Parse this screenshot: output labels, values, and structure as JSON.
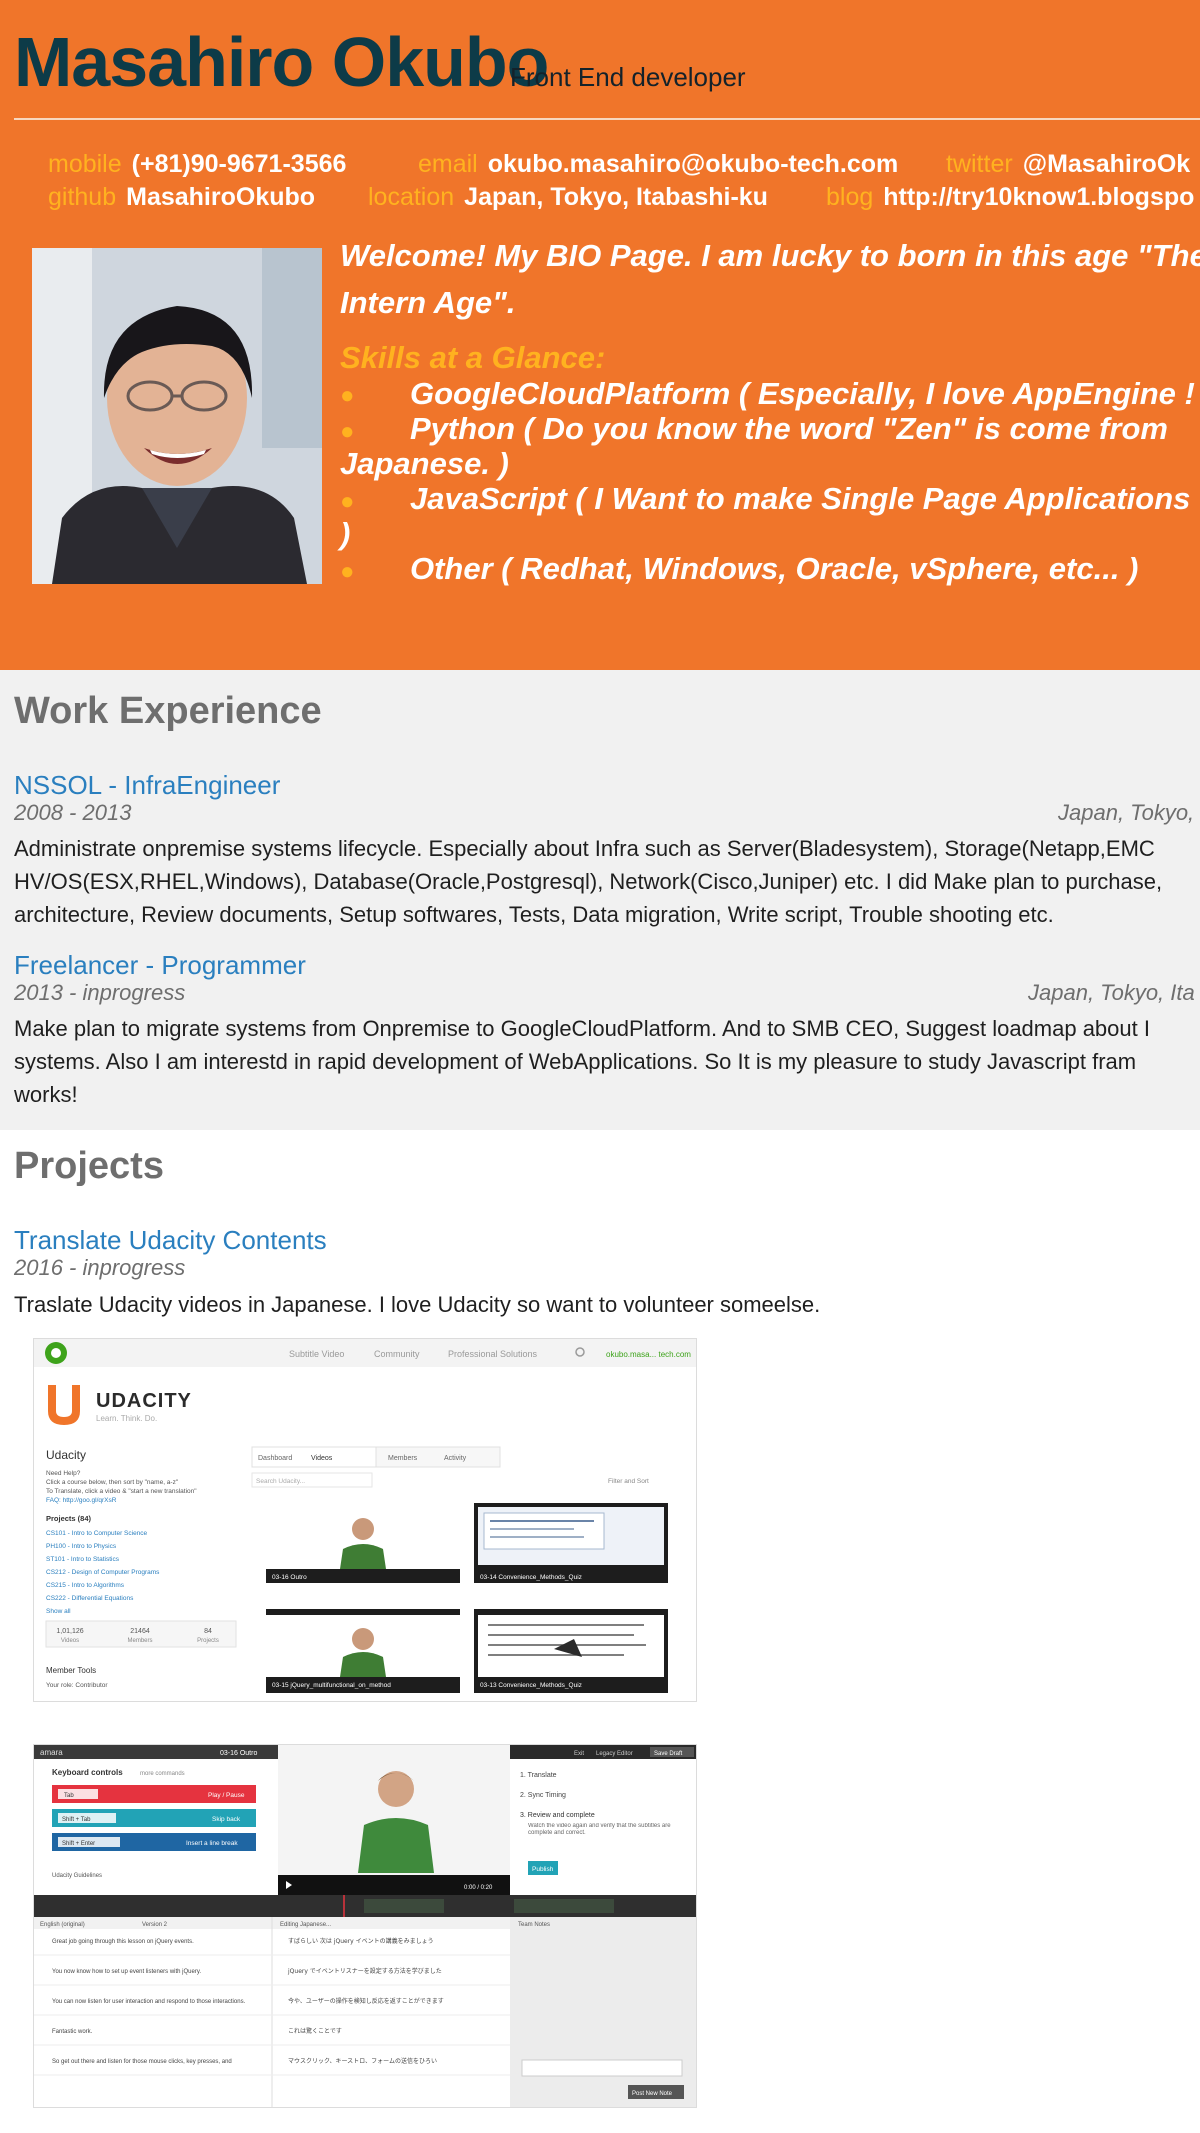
{
  "header": {
    "name": "Masahiro Okubo",
    "role": "Front End developer",
    "contacts": {
      "mobile": {
        "label": "mobile",
        "value": "(+81)90-9671-3566"
      },
      "email": {
        "label": "email",
        "value": "okubo.masahiro@okubo-tech.com"
      },
      "twitter": {
        "label": "twitter",
        "value": "@MasahiroOk"
      },
      "github": {
        "label": "github",
        "value": "MasahiroOkubo"
      },
      "location": {
        "label": "location",
        "value": "Japan, Tokyo, Itabashi-ku"
      },
      "blog": {
        "label": "blog",
        "value": "http://try10know1.blogspo"
      }
    },
    "bio": "Welcome! My BIO Page. I am lucky to born in this age \"The-Intern Age\".",
    "skills_title": "Skills at a Glance:",
    "skills": {
      "s1": "GoogleCloudPlatform ( Especially, I love AppEngine ! )",
      "s2a": "Python ( Do you know the word \"Zen\" is come from",
      "s2b": "Japanese. )",
      "s3a": "JavaScript ( I Want to make Single Page Applications",
      "s3b": ")",
      "s4": "Other ( Redhat, Windows, Oracle, vSphere, etc... )"
    }
  },
  "work": {
    "title": "Work Experience",
    "jobs": [
      {
        "title": "NSSOL - InfraEngineer",
        "dates": "2008 - 2013",
        "location": "Japan, Tokyo,",
        "desc1": "Administrate onpremise systems lifecycle. Especially about Infra such as Server(Bladesystem), Storage(Netapp,EMC",
        "desc2": "HV/OS(ESX,RHEL,Windows), Database(Oracle,Postgresql), Network(Cisco,Juniper) etc. I did Make plan to purchase,",
        "desc3": "architecture, Review documents, Setup softwares, Tests, Data migration, Write script, Trouble shooting etc."
      },
      {
        "title": "Freelancer - Programmer",
        "dates": "2013 - inprogress",
        "location": "Japan, Tokyo, Ita",
        "desc1": "Make plan to migrate systems from Onpremise to GoogleCloudPlatform. And to SMB CEO, Suggest loadmap about I",
        "desc2": "systems. Also I am interestd in rapid development of WebApplications. So It is my pleasure to study Javascript fram",
        "desc3": "works!"
      }
    ]
  },
  "projects": {
    "title": "Projects",
    "items": [
      {
        "title": "Translate Udacity Contents",
        "dates": "2016 - inprogress",
        "desc": "Traslate Udacity videos in Japanese. I love Udacity so want to volunteer someelse."
      }
    ]
  },
  "screenshot1": {
    "nav": [
      "Subtitle Video",
      "Community",
      "Professional Solutions"
    ],
    "user": "okubo.masa... tech.com",
    "brand": "UDACITY",
    "tagline": "Learn. Think. Do.",
    "team": "Udacity",
    "help1": "Need Help?",
    "help2": "Click a course below, then sort by \"name, a-z\"",
    "help3": "To Translate, click a video & \"start a new translation\"",
    "help4": "FAQ: http://goo.gl/qrXsR",
    "projects_label": "Projects (84)",
    "courses": [
      "CS101 - Intro to Computer Science",
      "PH100 - Intro to Physics",
      "ST101 - Intro to Statistics",
      "CS212 - Design of Computer Programs",
      "CS215 - Intro to Algorithms",
      "CS222 - Differential Equations"
    ],
    "show_all": "Show all",
    "stats": [
      {
        "n": "1,01,126",
        "l": "Videos"
      },
      {
        "n": "21464",
        "l": "Members"
      },
      {
        "n": "84",
        "l": "Projects"
      }
    ],
    "member_tools": "Member Tools",
    "role": "Your role: Contributor",
    "tabs": [
      "Dashboard",
      "Videos",
      "Members",
      "Activity"
    ],
    "search_placeholder": "Search Udacity...",
    "filter": "Filter and Sort",
    "thumbs": [
      "03-16 Outro",
      "03-14 Convenience_Methods_Quiz",
      "03-15 jQuery_multifunctional_on_method",
      "03-13 Convenience_Methods_Quiz"
    ]
  },
  "screenshot2": {
    "logo": "amara",
    "video": "03-16 Outro",
    "kb_title": "Keyboard controls",
    "kb_more": "more commands",
    "kb_rows": [
      {
        "key": "Tab",
        "action": "Play / Pause"
      },
      {
        "key": "Shift + Tab",
        "action": "Skip back"
      },
      {
        "key": "Shift + Enter",
        "action": "Insert a line break"
      }
    ],
    "guidelines": "Udacity Guidelines",
    "steps": [
      "1. Translate",
      "2. Sync Timing",
      "3. Review and complete"
    ],
    "review_text": "Watch the video again and verify that the subtitles are complete and correct.",
    "publish": "Publish",
    "topbar": [
      "Exit",
      "Legacy Editor",
      "Save Draft"
    ],
    "time": "0:00 / 0:20",
    "col1": "English (original)",
    "col1b": "Version 2",
    "col2": "Editing Japanese...",
    "notes": "Team Notes",
    "rows_en": [
      "Great job going through this lesson on jQuery events.",
      "You now know how to set up event listeners with jQuery.",
      "You can now listen for user interaction and respond to those interactions.",
      "Fantastic work.",
      "So get out there and listen for those mouse clicks, key presses, and"
    ],
    "rows_ja": [
      "すばらしい 次は jQuery イベントの講義をみましょう",
      "jQuery でイベントリスナーを設定する方法を学びました",
      "今や、ユーザーの操作を検知し反応を返すことができます",
      "これは驚くことです",
      "マウスクリック、キーストロ、フォームの送信をひろい"
    ],
    "post_note": "Post New Note"
  }
}
